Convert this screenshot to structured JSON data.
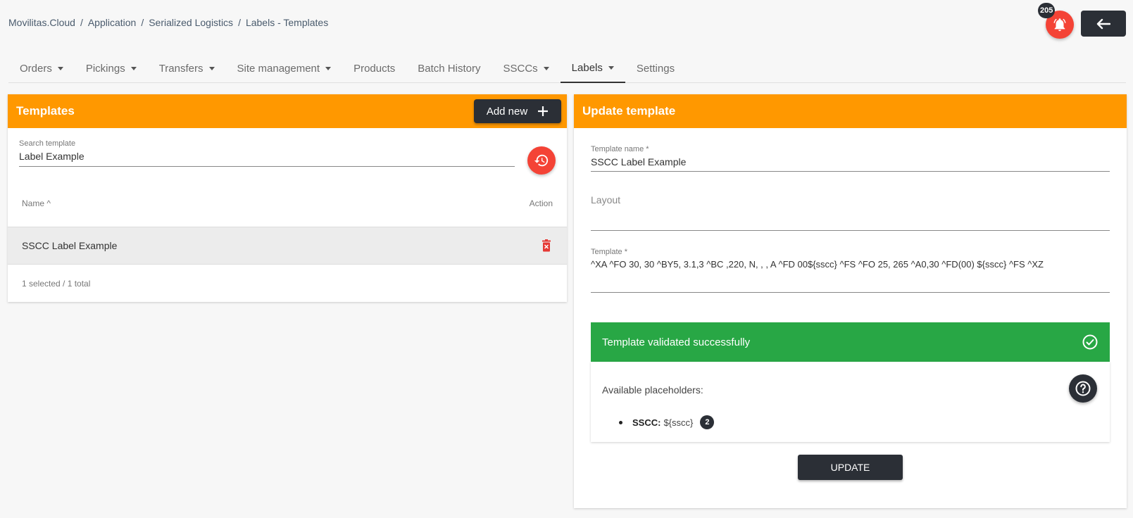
{
  "breadcrumb": [
    "Movilitas.Cloud",
    "Application",
    "Serialized Logistics",
    "Labels - Templates"
  ],
  "notifications": {
    "count": "205"
  },
  "nav": {
    "items": [
      {
        "label": "Orders",
        "dropdown": true
      },
      {
        "label": "Pickings",
        "dropdown": true
      },
      {
        "label": "Transfers",
        "dropdown": true
      },
      {
        "label": "Site management",
        "dropdown": true
      },
      {
        "label": "Products",
        "dropdown": false
      },
      {
        "label": "Batch History",
        "dropdown": false
      },
      {
        "label": "SSCCs",
        "dropdown": true
      },
      {
        "label": "Labels",
        "dropdown": true,
        "active": true
      },
      {
        "label": "Settings",
        "dropdown": false
      }
    ]
  },
  "templates_panel": {
    "title": "Templates",
    "add_label": "Add new",
    "search": {
      "label": "Search template",
      "value": "Label Example"
    },
    "columns": {
      "name": "Name ^",
      "action": "Action"
    },
    "rows": [
      {
        "name": "SSCC Label Example"
      }
    ],
    "footer": "1 selected / 1 total"
  },
  "update_panel": {
    "title": "Update template",
    "name_field": {
      "label": "Template name *",
      "value": "SSCC Label Example"
    },
    "layout_field": {
      "label": "Layout"
    },
    "template_field": {
      "label": "Template *",
      "value": "^XA  ^FO 30, 30 ^BY5, 3.1,3 ^BC ,220, N, , , A ^FD 00${sscc} ^FS ^FO 25, 265 ^A0,30 ^FD(00) ${sscc} ^FS ^XZ"
    },
    "validation_message": "Template validated successfully",
    "placeholders_title": "Available placeholders:",
    "placeholders": [
      {
        "key": "SSCC:",
        "value": "${sscc}",
        "count": "2"
      }
    ],
    "update_label": "UPDATE"
  },
  "colors": {
    "accent": "#ff9800",
    "success": "#28a745",
    "danger": "#f44336",
    "dark": "#2b2f36"
  }
}
